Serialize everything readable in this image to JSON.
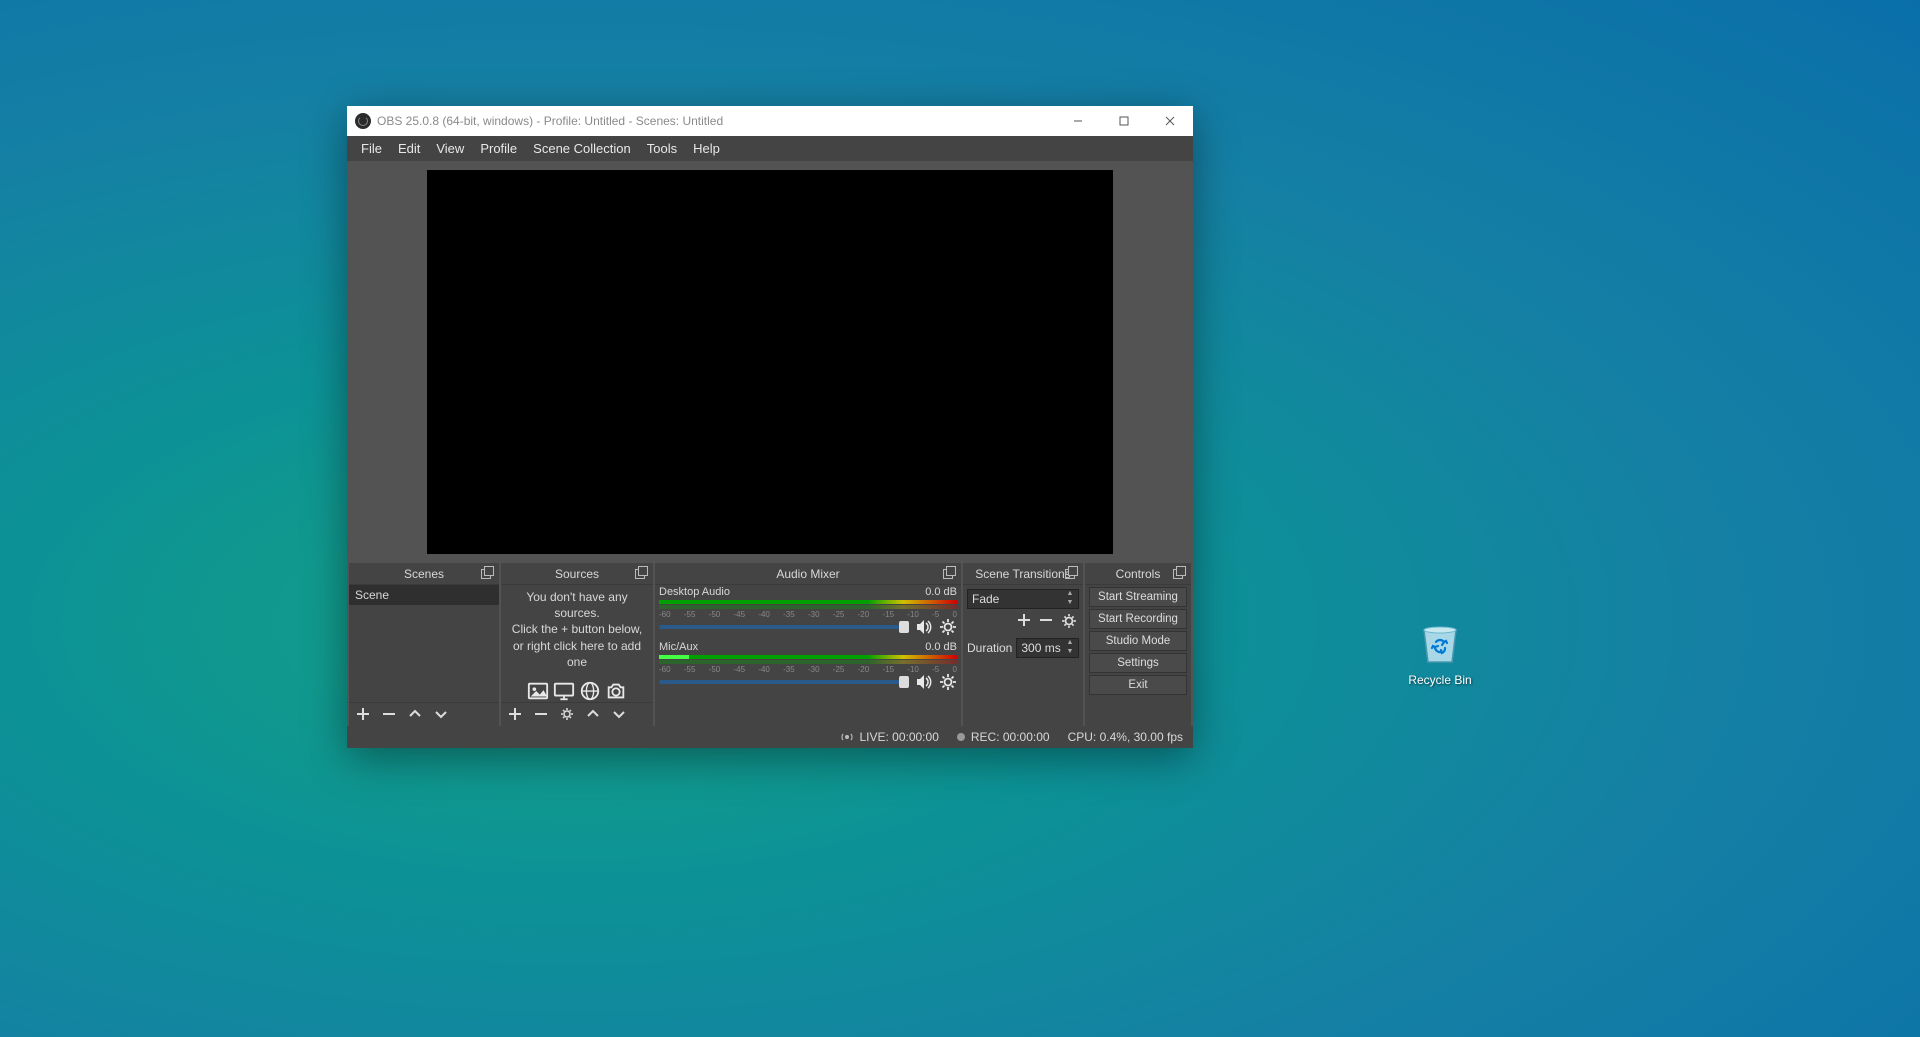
{
  "desktop": {
    "recycle_bin": "Recycle Bin"
  },
  "window": {
    "title": "OBS 25.0.8 (64-bit, windows) - Profile: Untitled - Scenes: Untitled"
  },
  "menu": {
    "items": [
      "File",
      "Edit",
      "View",
      "Profile",
      "Scene Collection",
      "Tools",
      "Help"
    ]
  },
  "docks": {
    "scenes": {
      "title": "Scenes",
      "items": [
        "Scene"
      ]
    },
    "sources": {
      "title": "Sources",
      "empty_l1": "You don't have any sources.",
      "empty_l2": "Click the + button below,",
      "empty_l3": "or right click here to add one"
    },
    "mixer": {
      "title": "Audio Mixer",
      "channels": [
        {
          "name": "Desktop Audio",
          "level": "0.0 dB"
        },
        {
          "name": "Mic/Aux",
          "level": "0.0 dB"
        }
      ],
      "ticks": [
        "-60",
        "-55",
        "-50",
        "-45",
        "-40",
        "-35",
        "-30",
        "-25",
        "-20",
        "-15",
        "-10",
        "-5",
        "0"
      ]
    },
    "transitions": {
      "title": "Scene Transitions",
      "selected": "Fade",
      "duration_label": "Duration",
      "duration_value": "300 ms"
    },
    "controls": {
      "title": "Controls",
      "buttons": [
        "Start Streaming",
        "Start Recording",
        "Studio Mode",
        "Settings",
        "Exit"
      ]
    }
  },
  "status": {
    "live": "LIVE: 00:00:00",
    "rec": "REC: 00:00:00",
    "cpu": "CPU: 0.4%, 30.00 fps"
  }
}
